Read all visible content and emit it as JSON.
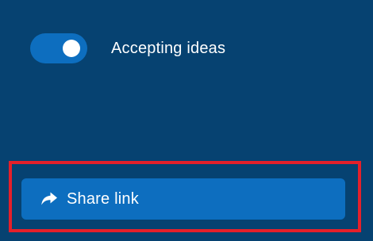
{
  "toggle": {
    "label": "Accepting ideas",
    "state": "on",
    "icon": "toggle-switch"
  },
  "share": {
    "label": "Share link",
    "icon": "share-arrow-icon"
  },
  "colors": {
    "background": "#064271",
    "accent": "#0d6ebf",
    "highlight": "#e4202a",
    "text": "#ffffff"
  }
}
